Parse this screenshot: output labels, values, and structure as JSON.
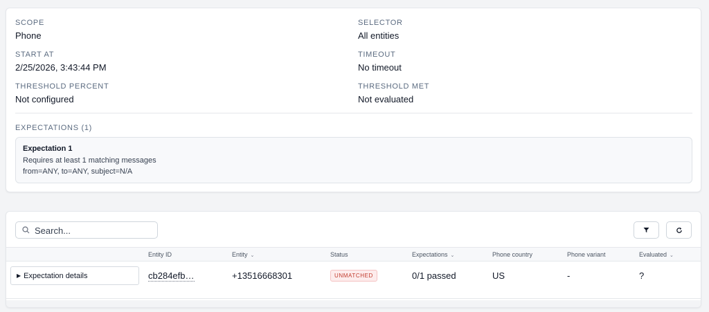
{
  "details": {
    "scope": {
      "label": "SCOPE",
      "value": "Phone"
    },
    "selector": {
      "label": "SELECTOR",
      "value": "All entities"
    },
    "start_at": {
      "label": "START AT",
      "value": "2/25/2026, 3:43:44 PM"
    },
    "timeout": {
      "label": "TIMEOUT",
      "value": "No timeout"
    },
    "threshold_percent": {
      "label": "THRESHOLD PERCENT",
      "value": "Not configured"
    },
    "threshold_met": {
      "label": "THRESHOLD MET",
      "value": "Not evaluated"
    }
  },
  "expectations": {
    "heading": "EXPECTATIONS (1)",
    "items": [
      {
        "title": "Expectation 1",
        "line1": "Requires at least 1 matching messages",
        "line2": "from=ANY, to=ANY, subject=N/A"
      }
    ]
  },
  "table": {
    "search_placeholder": "Search...",
    "search_value": "",
    "filter_icon": "filter-icon",
    "refresh_icon": "refresh-icon",
    "columns": {
      "entity_id": "Entity ID",
      "entity": "Entity",
      "status": "Status",
      "expectations": "Expectations",
      "phone_country": "Phone country",
      "phone_variant": "Phone variant",
      "evaluated": "Evaluated"
    },
    "sortable_chevron": "⌄",
    "rows": [
      {
        "details_label": "Expectation details",
        "entity_id": "cb284efb…",
        "entity": "+13516668301",
        "status": "UNMATCHED",
        "expectations": "0/1 passed",
        "phone_country": "US",
        "phone_variant": "-",
        "evaluated": "?"
      }
    ]
  },
  "colors": {
    "label": "#5b6b80",
    "unmatched_badge_bg": "#fdecec",
    "unmatched_badge_text": "#c0392b"
  }
}
